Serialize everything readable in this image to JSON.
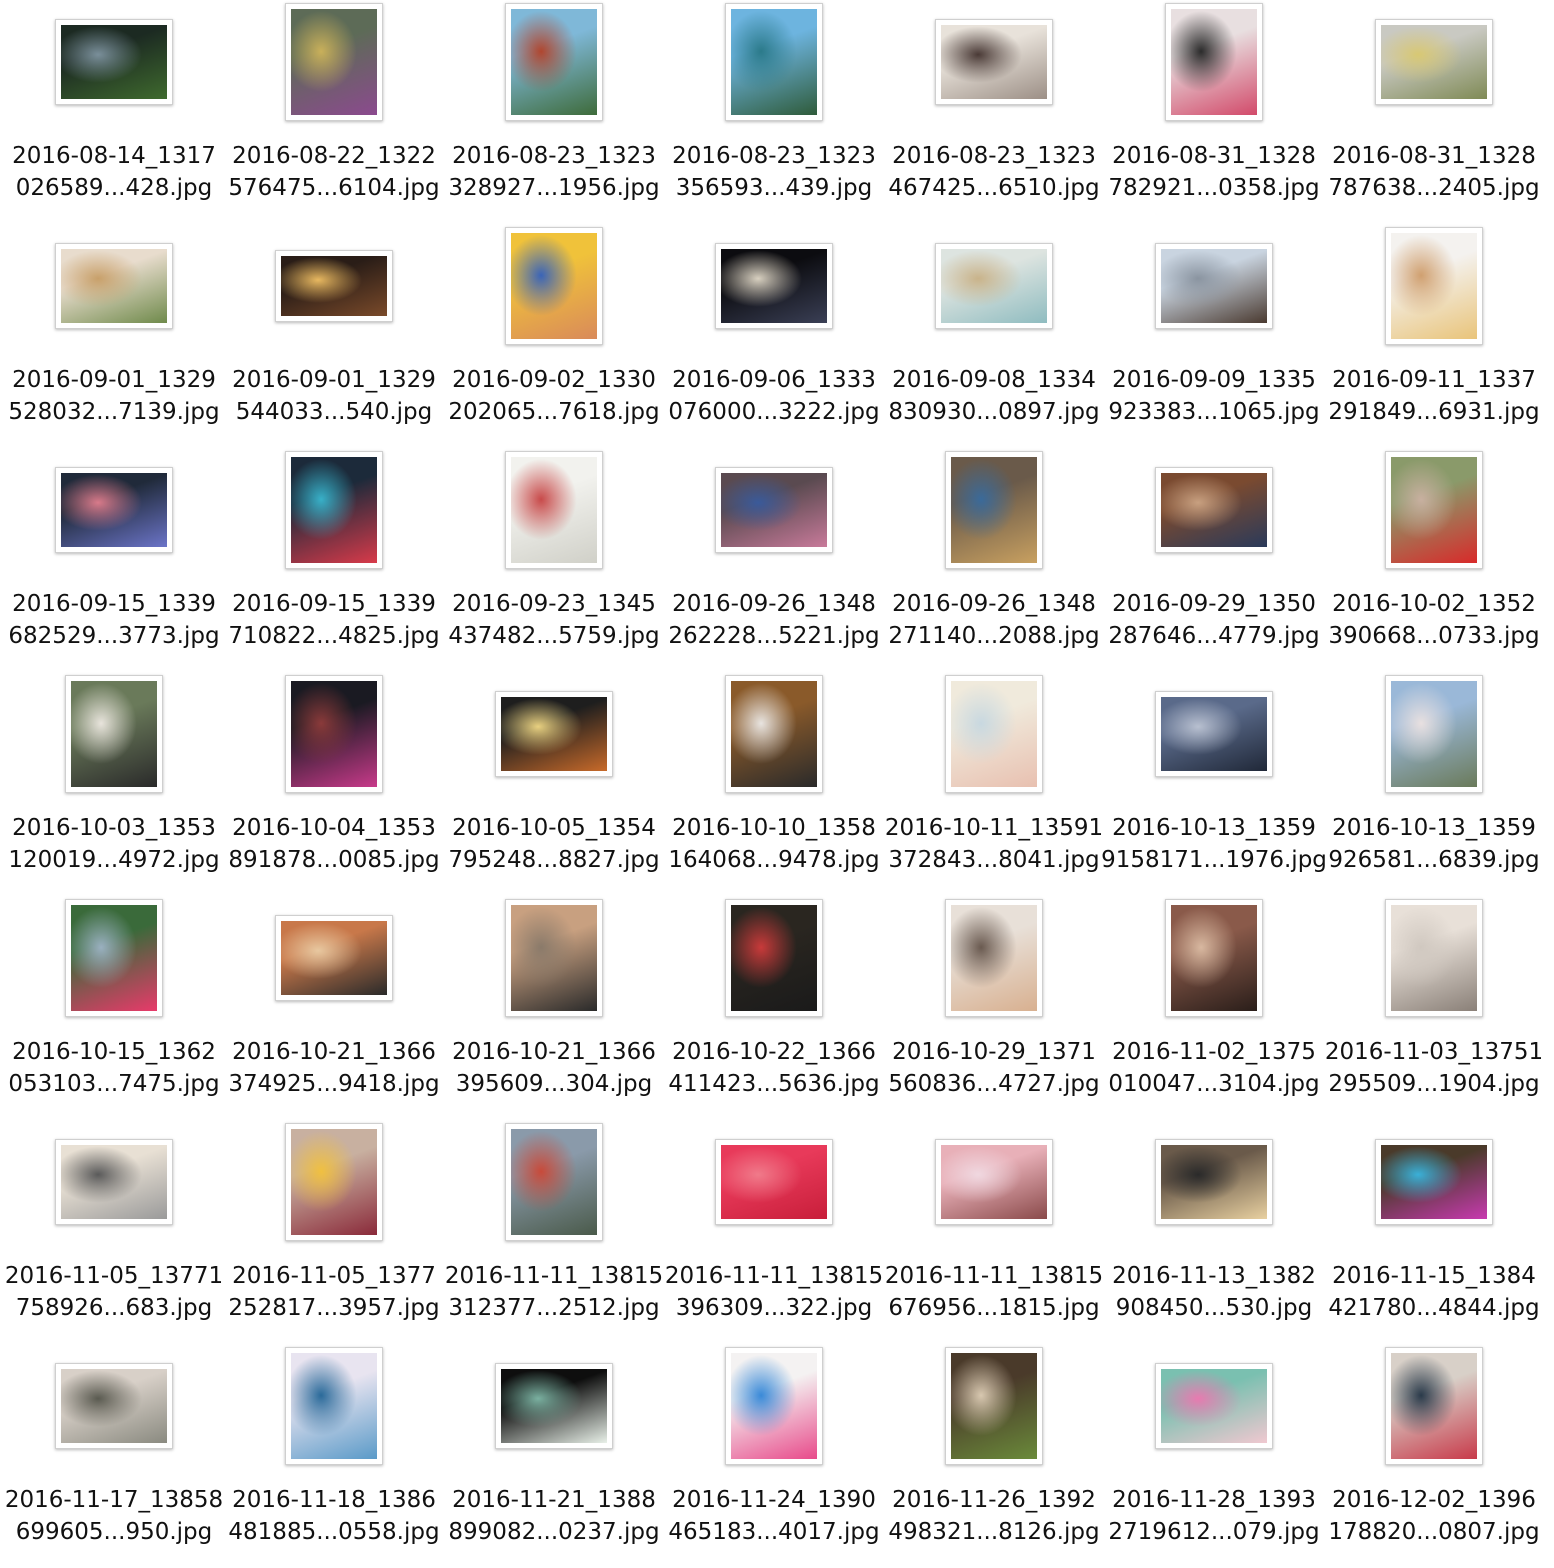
{
  "files": [
    {
      "line1": "2016-08-14_1317",
      "line2": "026589...428.jpg",
      "orientation": "landscape",
      "colors": [
        "#1c2a22",
        "#3f6a2e",
        "#7a8f9a"
      ]
    },
    {
      "line1": "2016-08-22_1322",
      "line2": "576475...6104.jpg",
      "orientation": "portrait",
      "colors": [
        "#5d6b57",
        "#8b4a8e",
        "#c9b05a"
      ]
    },
    {
      "line1": "2016-08-23_1323",
      "line2": "328927...1956.jpg",
      "orientation": "portrait",
      "colors": [
        "#7fb8d8",
        "#3e6b3a",
        "#b0462f"
      ]
    },
    {
      "line1": "2016-08-23_1323",
      "line2": "356593...439.jpg",
      "orientation": "portrait",
      "colors": [
        "#6db4df",
        "#2f5b3a",
        "#2b7a8a"
      ]
    },
    {
      "line1": "2016-08-23_1323",
      "line2": "467425...6510.jpg",
      "orientation": "landscape",
      "colors": [
        "#e8e2da",
        "#9c8f86",
        "#4a3a36"
      ]
    },
    {
      "line1": "2016-08-31_1328",
      "line2": "782921...0358.jpg",
      "orientation": "portrait",
      "colors": [
        "#e8dfe0",
        "#d24a6a",
        "#2b2b2b"
      ]
    },
    {
      "line1": "2016-08-31_1328",
      "line2": "787638...2405.jpg",
      "orientation": "landscape",
      "colors": [
        "#c9c9c2",
        "#7f8a55",
        "#d8c873"
      ]
    },
    {
      "line1": "2016-09-01_1329",
      "line2": "528032...7139.jpg",
      "orientation": "landscape",
      "colors": [
        "#e8dccd",
        "#6f8a4b",
        "#c8a06a"
      ]
    },
    {
      "line1": "2016-09-01_1329",
      "line2": "544033...540.jpg",
      "orientation": "landscape-wide",
      "colors": [
        "#2a1d17",
        "#7a4a2a",
        "#e8b860"
      ]
    },
    {
      "line1": "2016-09-02_1330",
      "line2": "202065...7618.jpg",
      "orientation": "portrait",
      "colors": [
        "#f0c23a",
        "#d98a5a",
        "#3a64b8"
      ]
    },
    {
      "line1": "2016-09-06_1333",
      "line2": "076000...3222.jpg",
      "orientation": "landscape",
      "colors": [
        "#0c0c10",
        "#3a3f55",
        "#d8d0c0"
      ]
    },
    {
      "line1": "2016-09-08_1334",
      "line2": "830930...0897.jpg",
      "orientation": "landscape",
      "colors": [
        "#dde4e0",
        "#8fbcc0",
        "#c9b38a"
      ]
    },
    {
      "line1": "2016-09-09_1335",
      "line2": "923383...1065.jpg",
      "orientation": "landscape",
      "colors": [
        "#c9d4e0",
        "#4a3a30",
        "#8a94a0"
      ]
    },
    {
      "line1": "2016-09-11_1337",
      "line2": "291849...6931.jpg",
      "orientation": "portrait",
      "colors": [
        "#f4f2ef",
        "#e9c47a",
        "#d0a070"
      ]
    },
    {
      "line1": "2016-09-15_1339",
      "line2": "682529...3773.jpg",
      "orientation": "landscape",
      "colors": [
        "#202a3a",
        "#6b74c8",
        "#d87a8a"
      ]
    },
    {
      "line1": "2016-09-15_1339",
      "line2": "710822...4825.jpg",
      "orientation": "portrait",
      "colors": [
        "#1c2a3a",
        "#d83a4a",
        "#38b0c8"
      ]
    },
    {
      "line1": "2016-09-23_1345",
      "line2": "437482...5759.jpg",
      "orientation": "portrait",
      "colors": [
        "#f2f2ee",
        "#d0d0c8",
        "#c84a4a"
      ]
    },
    {
      "line1": "2016-09-26_1348",
      "line2": "262228...5221.jpg",
      "orientation": "landscape",
      "colors": [
        "#5a4a50",
        "#c87a9a",
        "#3a5a9a"
      ]
    },
    {
      "line1": "2016-09-26_1348",
      "line2": "271140...2088.jpg",
      "orientation": "portrait",
      "colors": [
        "#6a5a4a",
        "#c8a060",
        "#3a6a9a"
      ]
    },
    {
      "line1": "2016-09-29_1350",
      "line2": "287646...4779.jpg",
      "orientation": "landscape",
      "colors": [
        "#7a4a30",
        "#2a3a5a",
        "#c8a080"
      ]
    },
    {
      "line1": "2016-10-02_1352",
      "line2": "390668...0733.jpg",
      "orientation": "portrait",
      "colors": [
        "#8a9a6a",
        "#d82a2a",
        "#c8b0a0"
      ]
    },
    {
      "line1": "2016-10-03_1353",
      "line2": "120019...4972.jpg",
      "orientation": "portrait",
      "colors": [
        "#6a7a5a",
        "#2a2a2a",
        "#e8e4dc"
      ]
    },
    {
      "line1": "2016-10-04_1353",
      "line2": "891878...0085.jpg",
      "orientation": "portrait",
      "colors": [
        "#1a1a22",
        "#c83a8a",
        "#8a3a3a"
      ]
    },
    {
      "line1": "2016-10-05_1354",
      "line2": "795248...8827.jpg",
      "orientation": "landscape",
      "colors": [
        "#1e1e1e",
        "#c86a2a",
        "#e8d080"
      ]
    },
    {
      "line1": "2016-10-10_1358",
      "line2": "164068...9478.jpg",
      "orientation": "portrait",
      "colors": [
        "#8a5a2a",
        "#2a2a2a",
        "#e8e4e0"
      ]
    },
    {
      "line1": "2016-10-11_13591",
      "line2": "372843...8041.jpg",
      "orientation": "portrait",
      "colors": [
        "#f0eadc",
        "#e8c0b0",
        "#c8d8e0"
      ]
    },
    {
      "line1": "2016-10-13_1359",
      "line2": "9158171...1976.jpg",
      "orientation": "landscape",
      "colors": [
        "#5a6a8a",
        "#202838",
        "#b8c0d0"
      ]
    },
    {
      "line1": "2016-10-13_1359",
      "line2": "926581...6839.jpg",
      "orientation": "portrait",
      "colors": [
        "#9ab8d8",
        "#6a7a5a",
        "#e8e0e0"
      ]
    },
    {
      "line1": "2016-10-15_1362",
      "line2": "053103...7475.jpg",
      "orientation": "portrait",
      "colors": [
        "#3a6a3a",
        "#e83a6a",
        "#9ab0c0"
      ]
    },
    {
      "line1": "2016-10-21_1366",
      "line2": "374925...9418.jpg",
      "orientation": "landscape",
      "colors": [
        "#c8784a",
        "#2a2a2a",
        "#e8c8a0"
      ]
    },
    {
      "line1": "2016-10-21_1366",
      "line2": "395609...304.jpg",
      "orientation": "portrait",
      "colors": [
        "#c8a080",
        "#2a2a2a",
        "#8a7a6a"
      ]
    },
    {
      "line1": "2016-10-22_1366",
      "line2": "411423...5636.jpg",
      "orientation": "portrait",
      "colors": [
        "#2a2620",
        "#1a1a1a",
        "#c83a3a"
      ]
    },
    {
      "line1": "2016-10-29_1371",
      "line2": "560836...4727.jpg",
      "orientation": "portrait",
      "colors": [
        "#e8e0d8",
        "#d8b090",
        "#6a5a50"
      ]
    },
    {
      "line1": "2016-11-02_1375",
      "line2": "010047...3104.jpg",
      "orientation": "portrait",
      "colors": [
        "#8a5a4a",
        "#2a1e1a",
        "#d8b8a0"
      ]
    },
    {
      "line1": "2016-11-03_13751",
      "line2": "295509...1904.jpg",
      "orientation": "portrait",
      "colors": [
        "#e8e0d8",
        "#8a8078",
        "#d0c8c0"
      ]
    },
    {
      "line1": "2016-11-05_13771",
      "line2": "758926...683.jpg",
      "orientation": "landscape",
      "colors": [
        "#e8e0d4",
        "#9a9a9a",
        "#5a5a5a"
      ]
    },
    {
      "line1": "2016-11-05_1377",
      "line2": "252817...3957.jpg",
      "orientation": "portrait",
      "colors": [
        "#c8b0a0",
        "#8a2a3a",
        "#f0c040"
      ]
    },
    {
      "line1": "2016-11-11_13815",
      "line2": "312377...2512.jpg",
      "orientation": "portrait",
      "colors": [
        "#8a9aaa",
        "#4a5a4a",
        "#c84a3a"
      ]
    },
    {
      "line1": "2016-11-11_13815",
      "line2": "396309...322.jpg",
      "orientation": "landscape",
      "colors": [
        "#e83a5a",
        "#c81e3a",
        "#f07a8a"
      ]
    },
    {
      "line1": "2016-11-11_13815",
      "line2": "676956...1815.jpg",
      "orientation": "landscape",
      "colors": [
        "#e8b0b8",
        "#8a4a4a",
        "#f0d8e0"
      ]
    },
    {
      "line1": "2016-11-13_1382",
      "line2": "908450...530.jpg",
      "orientation": "landscape",
      "colors": [
        "#6a5a4a",
        "#e8d0a0",
        "#2a2a2a"
      ]
    },
    {
      "line1": "2016-11-15_1384",
      "line2": "421780...4844.jpg",
      "orientation": "landscape",
      "colors": [
        "#4a3a2a",
        "#c83ab0",
        "#3ab0d8"
      ]
    },
    {
      "line1": "2016-11-17_13858",
      "line2": "699605...950.jpg",
      "orientation": "landscape",
      "colors": [
        "#d8d0c8",
        "#8a8a80",
        "#5a5a50"
      ]
    },
    {
      "line1": "2016-11-18_1386",
      "line2": "481885...0558.jpg",
      "orientation": "portrait",
      "colors": [
        "#e8e4f0",
        "#5a9ac8",
        "#2a6a9a"
      ]
    },
    {
      "line1": "2016-11-21_1388",
      "line2": "899082...0237.jpg",
      "orientation": "landscape",
      "colors": [
        "#0e0e0e",
        "#e8f0e8",
        "#7ab0a0"
      ]
    },
    {
      "line1": "2016-11-24_1390",
      "line2": "465183...4017.jpg",
      "orientation": "portrait",
      "colors": [
        "#f4f2f2",
        "#e84a8a",
        "#3a8ad8"
      ]
    },
    {
      "line1": "2016-11-26_1392",
      "line2": "498321...8126.jpg",
      "orientation": "portrait",
      "colors": [
        "#4a3a2a",
        "#6a8a3a",
        "#d8c8b0"
      ]
    },
    {
      "line1": "2016-11-28_1393",
      "line2": "2719612...079.jpg",
      "orientation": "landscape",
      "colors": [
        "#7ac0b0",
        "#f0c8d0",
        "#e87ab0"
      ]
    },
    {
      "line1": "2016-12-02_1396",
      "line2": "178820...0807.jpg",
      "orientation": "portrait",
      "colors": [
        "#d8d0c8",
        "#c83a4a",
        "#2a3a4a"
      ]
    }
  ]
}
